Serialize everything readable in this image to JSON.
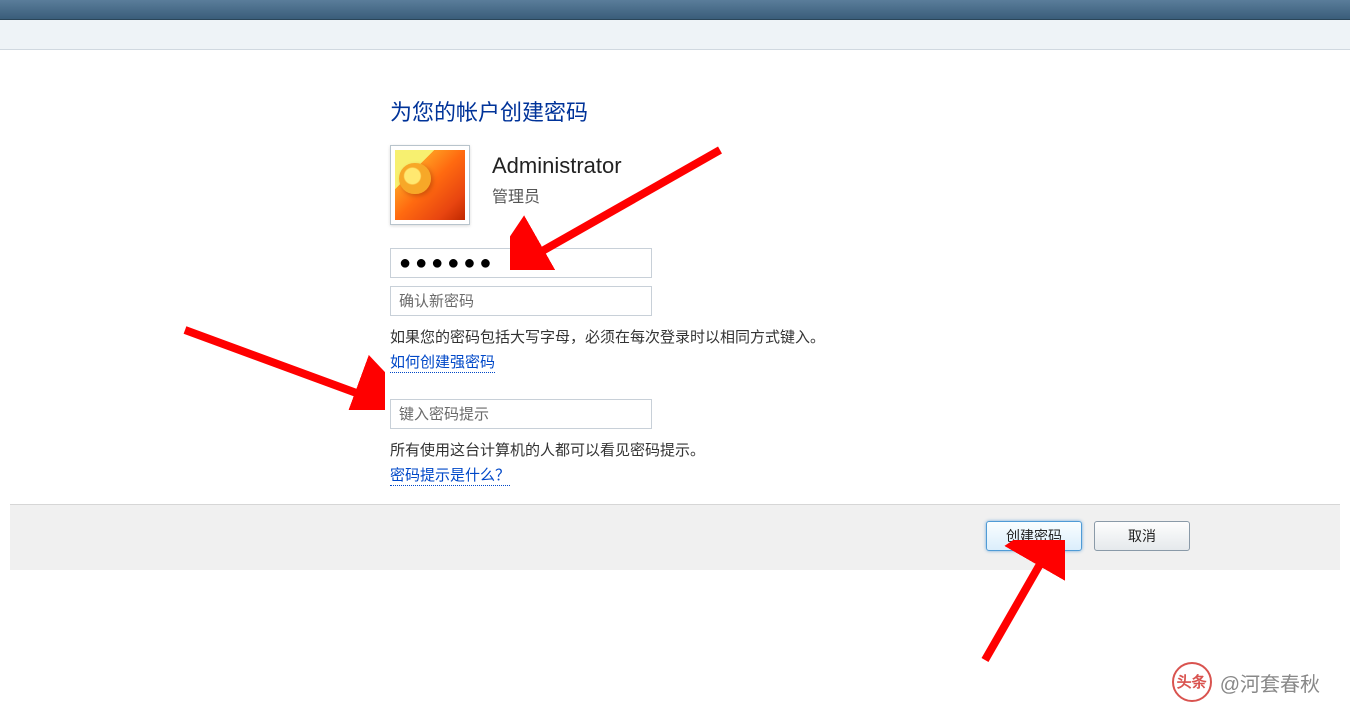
{
  "page": {
    "title": "为您的帐户创建密码"
  },
  "user": {
    "name": "Administrator",
    "role": "管理员"
  },
  "form": {
    "password_value": "●●●●●●",
    "confirm_placeholder": "确认新密码",
    "caps_note": "如果您的密码包括大写字母，必须在每次登录时以相同方式键入。",
    "strong_pw_link": "如何创建强密码",
    "hint_placeholder": "键入密码提示",
    "hint_note": "所有使用这台计算机的人都可以看见密码提示。",
    "hint_help_link": "密码提示是什么？"
  },
  "buttons": {
    "create": "创建密码",
    "cancel": "取消"
  },
  "watermark": {
    "badge": "头条",
    "text": "@河套春秋"
  }
}
